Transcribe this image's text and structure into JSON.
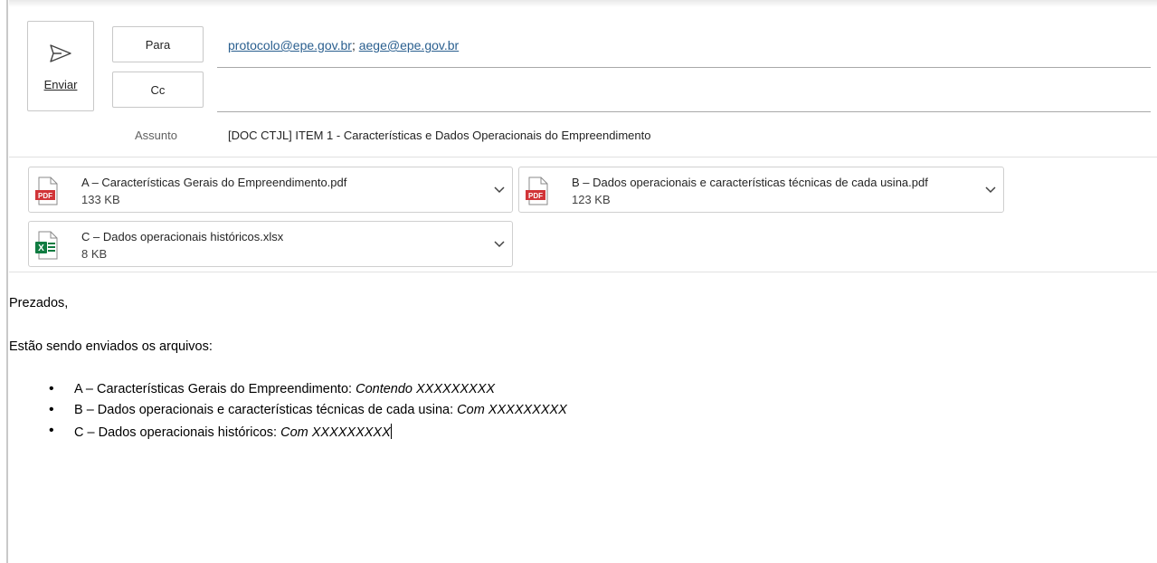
{
  "compose": {
    "send_label": "Enviar",
    "to_button": "Para",
    "cc_button": "Cc",
    "subject_label": "Assunto",
    "recipients": [
      "protocolo@epe.gov.br",
      "aege@epe.gov.br"
    ],
    "recipient_separator": ";",
    "subject": "[DOC CTJL] ITEM 1 - Características e Dados Operacionais do Empreendimento"
  },
  "attachments": [
    {
      "name": "A – Características Gerais do Empreendimento.pdf",
      "size": "133 KB",
      "icon": "pdf-file-icon"
    },
    {
      "name": "B – Dados operacionais e características técnicas de cada usina.pdf",
      "size": "123 KB",
      "icon": "pdf-file-icon"
    },
    {
      "name": "C – Dados operacionais históricos.xlsx",
      "size": "8 KB",
      "icon": "excel-file-icon"
    }
  ],
  "body": {
    "greeting": "Prezados,",
    "intro": "Estão sendo enviados os arquivos:",
    "items": [
      {
        "label": "A – Características Gerais do Empreendimento: ",
        "detail": "Contendo XXXXXXXXX"
      },
      {
        "label": "B – Dados operacionais e características técnicas de cada usina: ",
        "detail": "Com XXXXXXXXX"
      },
      {
        "label": "C – Dados operacionais históricos: ",
        "detail": "Com XXXXXXXXX"
      }
    ]
  },
  "colors": {
    "link": "#2a5f8f",
    "pdf_red": "#d13438",
    "excel_green": "#107c41"
  }
}
